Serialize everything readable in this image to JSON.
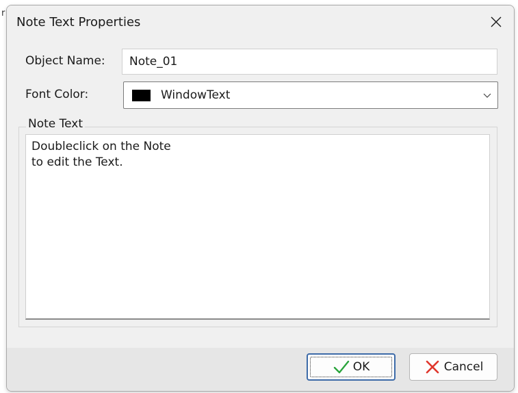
{
  "edge_glyph": "r",
  "dialog": {
    "title": "Note Text Properties"
  },
  "object_name": {
    "label": "Object Name:",
    "value": "Note_01"
  },
  "font_color": {
    "label": "Font Color:",
    "value": "WindowText",
    "swatch_color": "#000000"
  },
  "note_text": {
    "group_title": "Note Text",
    "content": "Doubleclick on the Note\nto edit the Text."
  },
  "buttons": {
    "ok_label": "OK",
    "cancel_label": "Cancel"
  },
  "icons": {
    "close": "close-icon",
    "chevron": "chevron-down-icon",
    "ok": "checkmark-icon",
    "cancel": "cross-icon"
  },
  "colors": {
    "ok_check": "#2aa43c",
    "cancel_cross": "#e0362c",
    "default_button_border": "#3c6aa8"
  }
}
